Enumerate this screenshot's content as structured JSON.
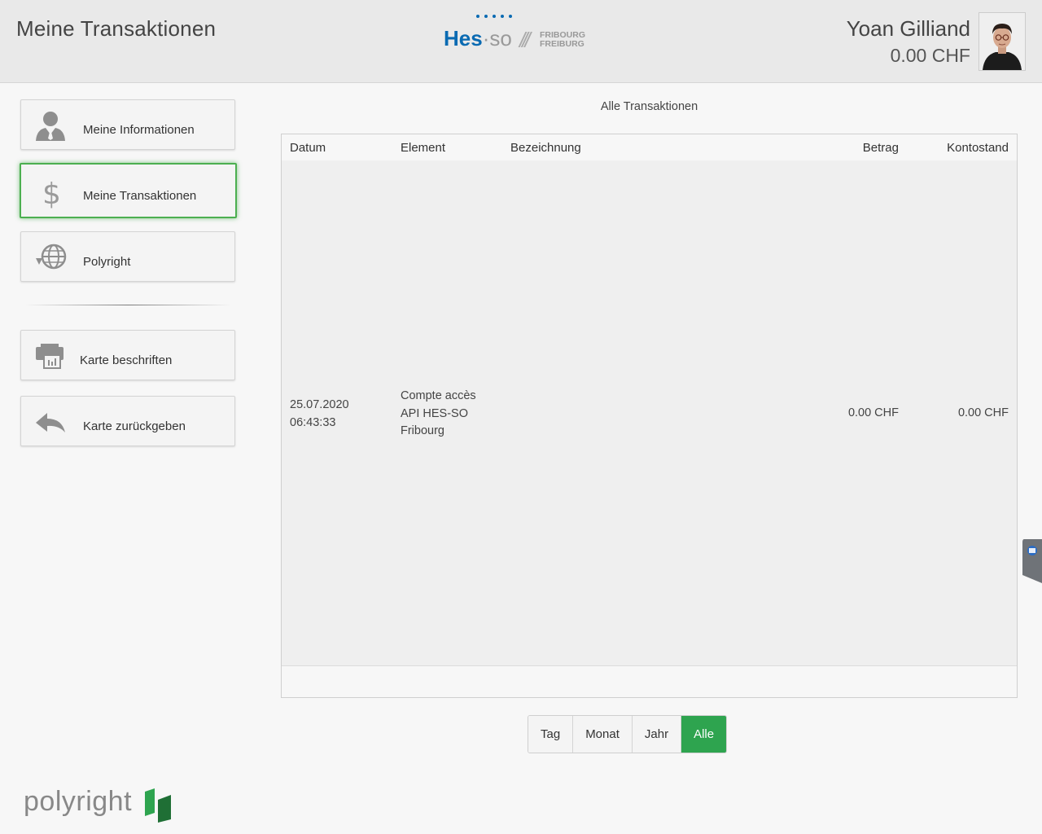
{
  "header": {
    "page_title": "Meine Transaktionen",
    "logo": {
      "hes": "Hes",
      "so": "so",
      "city_line1": "FRIBOURG",
      "city_line2": "FREIBURG"
    },
    "user_name": "Yoan Gilliand",
    "user_balance": "0.00 CHF"
  },
  "sidebar": {
    "items": [
      {
        "label": "Meine Informationen",
        "icon": "user-icon",
        "active": false
      },
      {
        "label": "Meine Transaktionen",
        "icon": "dollar-icon",
        "active": true
      },
      {
        "label": "Polyright",
        "icon": "globe-icon",
        "active": false
      },
      {
        "label": "Karte beschriften",
        "icon": "card-printer-icon",
        "active": false
      },
      {
        "label": "Karte zurückgeben",
        "icon": "return-arrow-icon",
        "active": false
      }
    ]
  },
  "transactions": {
    "title": "Alle Transaktionen",
    "columns": [
      "Datum",
      "Element",
      "Bezeichnung",
      "Betrag",
      "Kontostand"
    ],
    "rows": [
      {
        "date": "25.07.2020",
        "time": "06:43:33",
        "element_line1": "Compte accès",
        "element_line2": "API HES-SO",
        "element_line3": "Fribourg",
        "bezeichnung": "",
        "betrag": "0.00 CHF",
        "kontostand": "0.00 CHF"
      }
    ]
  },
  "filter": {
    "options": [
      "Tag",
      "Monat",
      "Jahr",
      "Alle"
    ],
    "selected": "Alle"
  },
  "brand": {
    "name": "polyright"
  },
  "colors": {
    "accent_green": "#2ea44f",
    "hes_blue": "#0a6ab2",
    "active_border": "#4caf50"
  }
}
